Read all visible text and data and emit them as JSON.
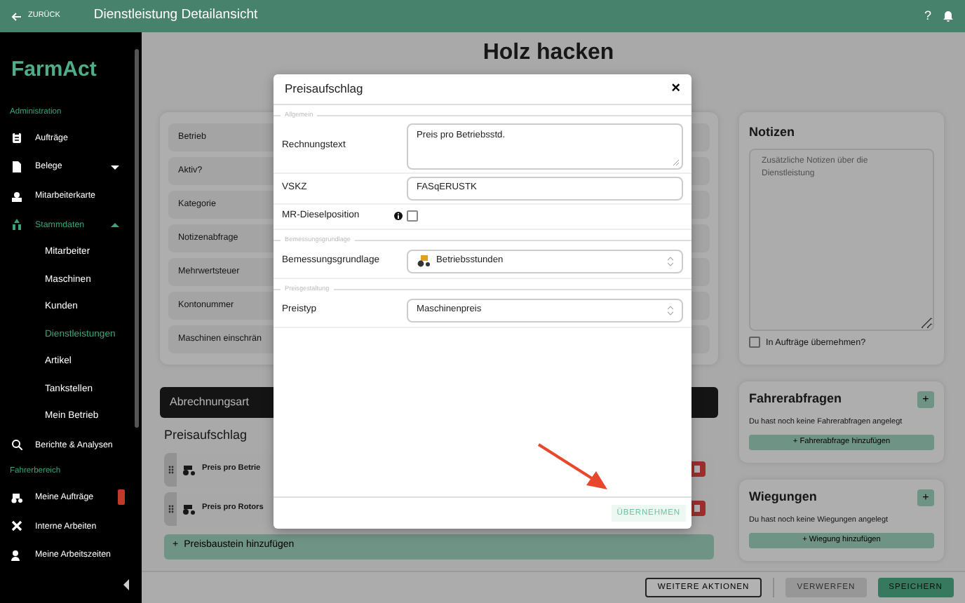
{
  "topbar": {
    "back": "ZURÜCK",
    "title": "Dienstleistung Detailansicht",
    "help": "?"
  },
  "sidebar": {
    "logo": "FarmAct",
    "sections": [
      {
        "label": "Administration",
        "items": [
          {
            "label": "Aufträge",
            "selected": false
          },
          {
            "label": "Belege",
            "selected": false,
            "expanded": false
          },
          {
            "label": "Mitarbeiterkarte",
            "selected": false
          },
          {
            "label": "Stammdaten",
            "selected": true,
            "expanded": true,
            "children": [
              {
                "label": "Mitarbeiter",
                "selected": false
              },
              {
                "label": "Maschinen",
                "selected": false
              },
              {
                "label": "Kunden",
                "selected": false
              },
              {
                "label": "Dienstleistungen",
                "selected": true
              },
              {
                "label": "Artikel",
                "selected": false
              },
              {
                "label": "Tankstellen",
                "selected": false
              },
              {
                "label": "Mein Betrieb",
                "selected": false
              }
            ]
          },
          {
            "label": "Berichte & Analysen",
            "selected": false
          }
        ]
      },
      {
        "label": "Fahrerbereich",
        "items": [
          {
            "label": "Meine Aufträge",
            "selected": false,
            "alert": true
          },
          {
            "label": "Interne Arbeiten",
            "selected": false
          },
          {
            "label": "Meine Arbeitszeiten",
            "selected": false
          }
        ]
      }
    ]
  },
  "page": {
    "title": "Holz hacken",
    "fields": [
      "Betrieb",
      "Aktiv?",
      "Kategorie",
      "Notizenabfrage",
      "Mehrwertsteuer",
      "Kontonummer",
      "Maschinen einschrän"
    ],
    "billing": {
      "header": "Abrechnungsart",
      "section": "Preisaufschlag",
      "rows": [
        "Preis pro Betrie",
        "Preis pro Rotors"
      ],
      "add_icon": "+",
      "add": "Preisbaustein hinzufügen"
    },
    "notes": {
      "title": "Notizen",
      "placeholder": "Zusätzliche Notizen über die Dienstleistung",
      "checkbox": {
        "label": "In Aufträge übernehmen?",
        "checked": false
      }
    },
    "panels": [
      {
        "title": "Fahrerabfragen",
        "add": "+",
        "empty": "Du hast noch keine Fahrerabfragen angelegt",
        "button": "+ Fahrerabfrage hinzufügen"
      },
      {
        "title": "Wiegungen",
        "add": "+",
        "empty": "Du hast noch keine Wiegungen angelegt",
        "button": "+ Wiegung hinzufügen"
      }
    ],
    "actions": [
      {
        "label": "WEITERE AKTIONEN",
        "kind": "outline"
      },
      {
        "label": "VERWERFEN",
        "kind": "secondary"
      },
      {
        "label": "SPEICHERN",
        "kind": "primary"
      }
    ]
  },
  "modal": {
    "title": "Preisaufschlag",
    "close": "×",
    "groups": [
      {
        "legend": "Allgemein",
        "fields": [
          {
            "kind": "textarea",
            "label": "Rechnungstext",
            "value": "Preis pro Betriebsstd."
          },
          {
            "kind": "input",
            "label": "VSKZ",
            "value": "FASqERUSTK"
          },
          {
            "kind": "checkbox",
            "label": "MR-Dieselposition",
            "checked": false,
            "info": true
          }
        ]
      },
      {
        "legend": "Bemessungsgrundlage",
        "fields": [
          {
            "kind": "select",
            "label": "Bemessungsgrundlage",
            "value": "Betriebsstunden",
            "icon": true
          }
        ]
      },
      {
        "legend": "Preisgestaltung",
        "fields": [
          {
            "kind": "select",
            "label": "Preistyp",
            "value": "Maschinenpreis"
          }
        ]
      }
    ],
    "confirm": "ÜBERNEHMEN"
  }
}
